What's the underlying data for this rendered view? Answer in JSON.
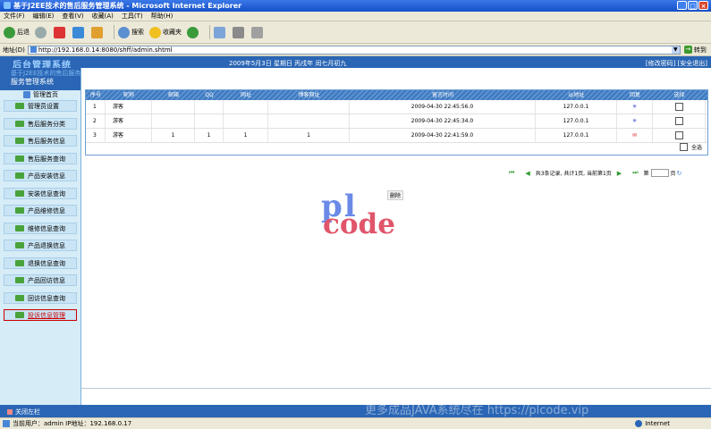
{
  "window": {
    "title": "基于J2EE技术的售后服务管理系统 - Microsoft Internet Explorer",
    "buttons": {
      "minimize": "_",
      "maximize": "□",
      "close": "×"
    }
  },
  "menubar": [
    "文件(F)",
    "编辑(E)",
    "查看(V)",
    "收藏(A)",
    "工具(T)",
    "帮助(H)"
  ],
  "toolbar": {
    "back": "后退",
    "search": "搜索",
    "favorites": "收藏夹"
  },
  "address": {
    "label": "地址(D)",
    "url": "http://192.168.0.14:8080/shff/admin.shtml",
    "go": "转到"
  },
  "app": {
    "logo": "后台管理系统",
    "date_text": "2009年5月3日 星期日 丙戌年 闰七月初九",
    "links": "[修改密码] [安全退出]"
  },
  "sidebar": {
    "subtitle": "基于J2EE技术的售后服务",
    "title": "服务管理系统",
    "home": "管理首页",
    "items": [
      {
        "label": "管理员设置"
      },
      {
        "label": "售后服务分类"
      },
      {
        "label": "售后服务信息"
      },
      {
        "label": "售后服务查询"
      },
      {
        "label": "产品安装信息"
      },
      {
        "label": "安装信息查询"
      },
      {
        "label": "产品维修信息"
      },
      {
        "label": "维修信息查询"
      },
      {
        "label": "产品退换信息"
      },
      {
        "label": "退换信息查询"
      },
      {
        "label": "产品回访信息"
      },
      {
        "label": "回访信息查询"
      },
      {
        "label": "投诉信息管理"
      }
    ]
  },
  "table": {
    "headers": [
      "序号",
      "昵称",
      "邮箱",
      "QQ",
      "网址",
      "博客网址",
      "留言时间",
      "ip地址",
      "回复",
      "选择"
    ],
    "rows": [
      {
        "no": "1",
        "nick": "游客",
        "email": "",
        "qq": "",
        "site": "",
        "blog": "",
        "time": "2009-04-30 22:45:56.0",
        "ip": "127.0.0.1",
        "reply": "✳"
      },
      {
        "no": "2",
        "nick": "游客",
        "email": "",
        "qq": "",
        "site": "",
        "blog": "",
        "time": "2009-04-30 22:45:34.0",
        "ip": "127.0.0.1",
        "reply": "✳"
      },
      {
        "no": "3",
        "nick": "游客",
        "email": "1",
        "qq": "1",
        "site": "1",
        "blog": "1",
        "time": "2009-04-30 22:41:59.0",
        "ip": "127.0.0.1",
        "reply": "✉"
      }
    ],
    "select_all": "全选"
  },
  "pager": {
    "summary": "共3条记录, 共计1页, 当前第1页",
    "goto_prefix": "第",
    "goto_suffix": "页"
  },
  "delete_button": "删除",
  "watermark": {
    "line1": "pl",
    "line2": "code"
  },
  "footer": {
    "close_left": "关闭左栏",
    "watermark_text": "更多成品JAVA系统尽在 https://plcode.vip"
  },
  "status": {
    "user": "当前用户：admin  IP地址：192.168.0.17",
    "zone": "Internet"
  },
  "colors": {
    "header_blue": "#2a66b5",
    "sidebar_bg": "#d6ecf7",
    "active_red": "#cc0000"
  }
}
